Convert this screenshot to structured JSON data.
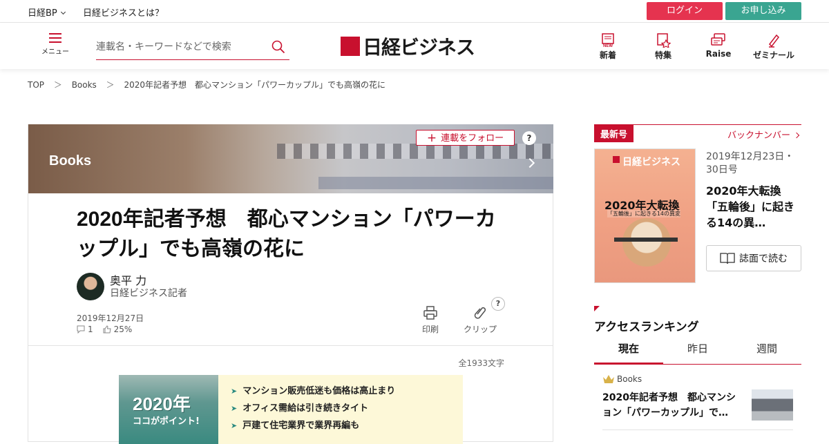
{
  "topbar": {
    "nikkei_bp": "日経BP",
    "about": "日経ビジネスとは？",
    "login": "ログイン",
    "apply": "お申し込み"
  },
  "header": {
    "menu_label": "メニュー",
    "search_placeholder": "連載名・キーワードなどで検索",
    "logo": "日経ビジネス",
    "nav": [
      {
        "label": "新着",
        "icon": "new-icon"
      },
      {
        "label": "特集",
        "icon": "feature-icon"
      },
      {
        "label": "Raise",
        "icon": "raise-icon"
      },
      {
        "label": "ゼミナール",
        "icon": "seminar-icon"
      }
    ],
    "brand_color": "#c8102e"
  },
  "breadcrumb": [
    "TOP",
    "Books",
    "2020年記者予想　都心マンション「パワーカップル」でも高嶺の花に"
  ],
  "breadcrumb_sep": "＞",
  "article": {
    "category": "Books",
    "follow_label": "連載をフォロー",
    "help": "?",
    "title": "2020年記者予想　都心マンション「パワーカップル」でも高嶺の花に",
    "author_name": "奥平 力",
    "author_role": "日経ビジネス記者",
    "date": "2019年12月27日",
    "comments": "1",
    "likes": "25%",
    "print_label": "印刷",
    "clip_label": "クリップ",
    "char_count": "全1933文字",
    "infographic": {
      "year": "2020年",
      "point": "ココがポイント!",
      "bullets": [
        "マンション販売低迷も価格は高止まり",
        "オフィス需給は引き続きタイト",
        "戸建て住宅業界で業界再編も"
      ]
    }
  },
  "sidebar": {
    "latest_label": "最新号",
    "back_numbers": "バックナンバー",
    "cover": {
      "logo": "日経ビジネス",
      "headline": "2020年大転換",
      "subline": "「五輪後」に起きる14の異変"
    },
    "issue_date": "2019年12月23日・30日号",
    "issue_title": "2020年大転換「五輪後」に起きる14の異…",
    "read_label": "誌面で読む",
    "ranking_title": "アクセスランキング",
    "ranking_tabs": [
      "現在",
      "昨日",
      "週間"
    ],
    "ranking_item": {
      "category": "Books",
      "title": "2020年記者予想　都心マンション「パワーカップル」で…"
    }
  }
}
